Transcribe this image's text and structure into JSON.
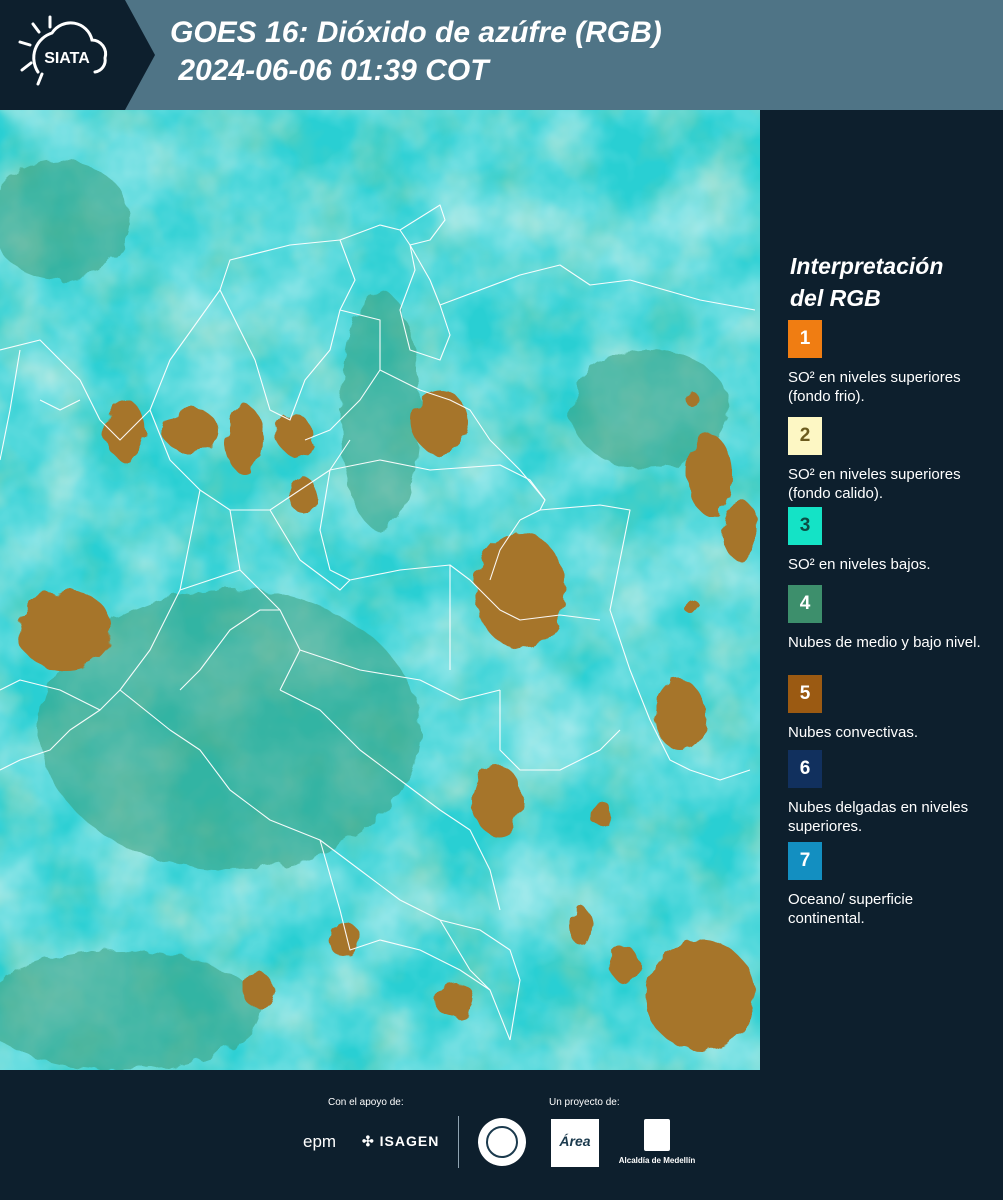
{
  "header": {
    "logo_text": "SIATA",
    "title": "GOES 16: Dióxido de azúfre (RGB)\n 2024-06-06 01:39 COT"
  },
  "legend": {
    "title": "Interpretación\ndel RGB",
    "items": [
      {
        "number": "1",
        "label": "SO² en niveles superiores (fondo frio).",
        "color": "#f07d12",
        "text_color": "#ffffff"
      },
      {
        "number": "2",
        "label": "SO² en niveles superiores (fondo calido).",
        "color": "#fdf7c4",
        "text_color": "#6b5b1e"
      },
      {
        "number": "3",
        "label": "SO² en niveles bajos.",
        "color": "#14e3c6",
        "text_color": "#0c4d44"
      },
      {
        "number": "4",
        "label": "Nubes de medio y bajo nivel.",
        "color": "#3d8f6c",
        "text_color": "#ffffff"
      },
      {
        "number": "5",
        "label": "Nubes convectivas.",
        "color": "#9b5a12",
        "text_color": "#ffffff"
      },
      {
        "number": "6",
        "label": "Nubes delgadas en niveles superiores.",
        "color": "#11305e",
        "text_color": "#ffffff"
      },
      {
        "number": "7",
        "label": "Oceano/ superficie continental.",
        "color": "#138fc1",
        "text_color": "#ffffff"
      }
    ]
  },
  "footer": {
    "support_label": "Con el apoyo de:",
    "project_label": "Un proyecto de:",
    "sponsor_epm": "epm",
    "sponsor_isagen": "ISAGEN",
    "partner_area": "Área",
    "partner_alcaldia": "Alcaldía de Medellín"
  },
  "colors": {
    "header_bg": "#4f7486",
    "panel_bg": "#0d1f2d",
    "map_ocean": "#27d3d6",
    "map_land": "#3ea882",
    "convective": "#9b6b22"
  }
}
